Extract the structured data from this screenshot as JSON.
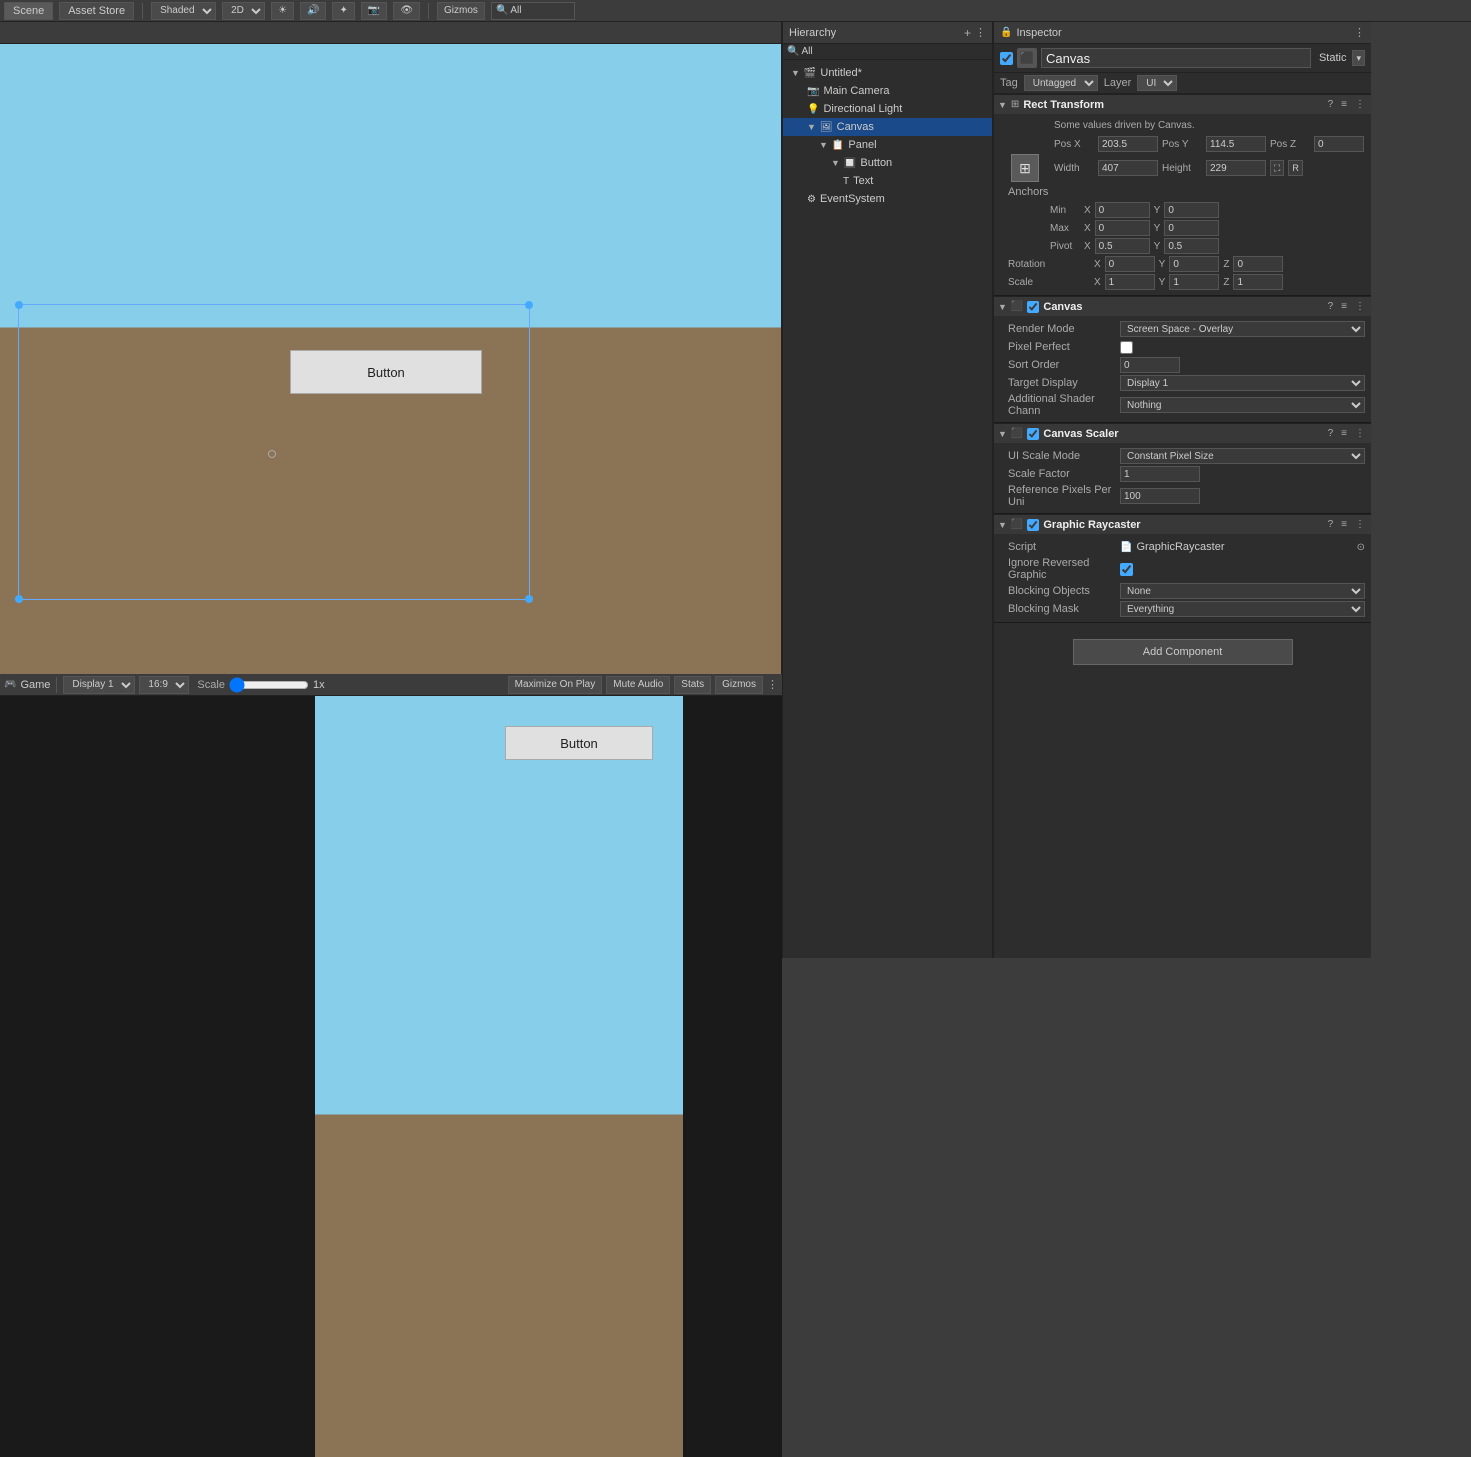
{
  "tabs": {
    "scene": "Scene",
    "asset_store": "Asset Store",
    "game": "Game",
    "hierarchy": "Hierarchy",
    "inspector": "Inspector"
  },
  "scene_toolbar": {
    "shading": "Shaded",
    "mode_2d": "2D",
    "gizmos": "Gizmos",
    "all": "All"
  },
  "hierarchy": {
    "search_placeholder": "All",
    "items": [
      {
        "label": "Untitled*",
        "level": 0,
        "expanded": true,
        "icon": "▼"
      },
      {
        "label": "Main Camera",
        "level": 1,
        "icon": "📷"
      },
      {
        "label": "Directional Light",
        "level": 1,
        "icon": "💡"
      },
      {
        "label": "Canvas",
        "level": 1,
        "expanded": true,
        "icon": "▼",
        "selected": true
      },
      {
        "label": "Panel",
        "level": 2,
        "expanded": true,
        "icon": "▼"
      },
      {
        "label": "Button",
        "level": 3,
        "expanded": true,
        "icon": "▼"
      },
      {
        "label": "Text",
        "level": 4,
        "icon": ""
      },
      {
        "label": "EventSystem",
        "level": 1,
        "icon": ""
      }
    ]
  },
  "inspector": {
    "object_name": "Canvas",
    "static_label": "Static",
    "tag_label": "Tag",
    "tag_value": "Untagged",
    "layer_label": "Layer",
    "layer_value": "UI",
    "sections": {
      "rect_transform": {
        "title": "Rect Transform",
        "driven_note": "Some values driven by Canvas.",
        "pos_x_label": "Pos X",
        "pos_y_label": "Pos Y",
        "pos_z_label": "Pos Z",
        "pos_x": "203.5",
        "pos_y": "114.5",
        "pos_z": "0",
        "width_label": "Width",
        "height_label": "Height",
        "width": "407",
        "height": "229",
        "anchors_label": "Anchors",
        "min_label": "Min",
        "min_x": "0",
        "min_y": "0",
        "max_label": "Max",
        "max_x": "0",
        "max_y": "0",
        "pivot_label": "Pivot",
        "pivot_x": "0.5",
        "pivot_y": "0.5",
        "rotation_label": "Rotation",
        "rot_x": "0",
        "rot_y": "0",
        "rot_z": "0",
        "scale_label": "Scale",
        "scale_x": "1",
        "scale_y": "1",
        "scale_z": "1"
      },
      "canvas": {
        "title": "Canvas",
        "render_mode_label": "Render Mode",
        "render_mode_value": "Screen Space - Overlay",
        "pixel_perfect_label": "Pixel Perfect",
        "sort_order_label": "Sort Order",
        "sort_order_value": "0",
        "target_display_label": "Target Display",
        "target_display_value": "Display 1",
        "additional_shader_label": "Additional Shader Chann",
        "additional_shader_value": "Nothing"
      },
      "canvas_scaler": {
        "title": "Canvas Scaler",
        "ui_scale_mode_label": "UI Scale Mode",
        "ui_scale_mode_value": "Constant Pixel Size",
        "scale_factor_label": "Scale Factor",
        "scale_factor_value": "1",
        "ref_pixels_label": "Reference Pixels Per Uni",
        "ref_pixels_value": "100"
      },
      "graphic_raycaster": {
        "title": "Graphic Raycaster",
        "script_label": "Script",
        "script_value": "GraphicRaycaster",
        "ignore_reversed_label": "Ignore Reversed Graphic",
        "blocking_objects_label": "Blocking Objects",
        "blocking_objects_value": "None",
        "blocking_mask_label": "Blocking Mask",
        "blocking_mask_value": "Everything"
      }
    },
    "add_component": "Add Component"
  },
  "scene_button_label": "Button",
  "game": {
    "display": "Display 1",
    "ratio": "16:9",
    "scale_label": "Scale",
    "scale_value": "1x",
    "maximize_label": "Maximize On Play",
    "mute_label": "Mute Audio",
    "stats_label": "Stats",
    "gizmos_label": "Gizmos",
    "button_label": "Button"
  }
}
